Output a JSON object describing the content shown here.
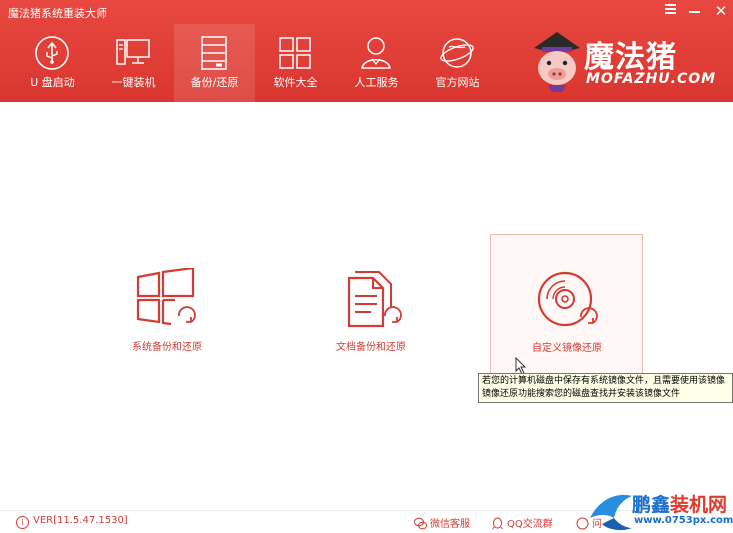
{
  "window": {
    "title": "魔法猪系统重装大师",
    "menu_icon": "menu-icon",
    "minimize_icon": "minimize-icon",
    "close_icon": "close-icon"
  },
  "nav": {
    "items": [
      {
        "label": "U 盘启动",
        "icon": "usb-icon"
      },
      {
        "label": "一键装机",
        "icon": "monitor-icon"
      },
      {
        "label": "备份/还原",
        "icon": "backup-icon",
        "active": true
      },
      {
        "label": "软件大全",
        "icon": "apps-grid-icon"
      },
      {
        "label": "人工服务",
        "icon": "person-icon"
      },
      {
        "label": "官方网站",
        "icon": "globe-icon"
      }
    ]
  },
  "logo": {
    "cn": "魔法猪",
    "en": "MOFAZHU.COM"
  },
  "options": [
    {
      "label": "系统备份和还原",
      "icon": "windows-restore-icon"
    },
    {
      "label": "文档备份和还原",
      "icon": "document-restore-icon"
    },
    {
      "label": "自定义镜像还原",
      "icon": "disc-restore-icon",
      "selected": true
    }
  ],
  "tooltip": {
    "line1": "若您的计算机磁盘中保存有系统镜像文件，且需要使用该镜像",
    "line2": "镜像还原功能搜索您的磁盘查找并安装该镜像文件"
  },
  "footer": {
    "version": "VER[11.5.47.1530]",
    "wechat": "微信客服",
    "qq": "QQ交流群",
    "help": "问"
  },
  "watermark": {
    "cn_part1": "鹏鑫",
    "cn_part2": "装机网",
    "url": "www.0753px.com"
  },
  "colors": {
    "accent": "#d9362f",
    "header_top": "#e84840"
  }
}
